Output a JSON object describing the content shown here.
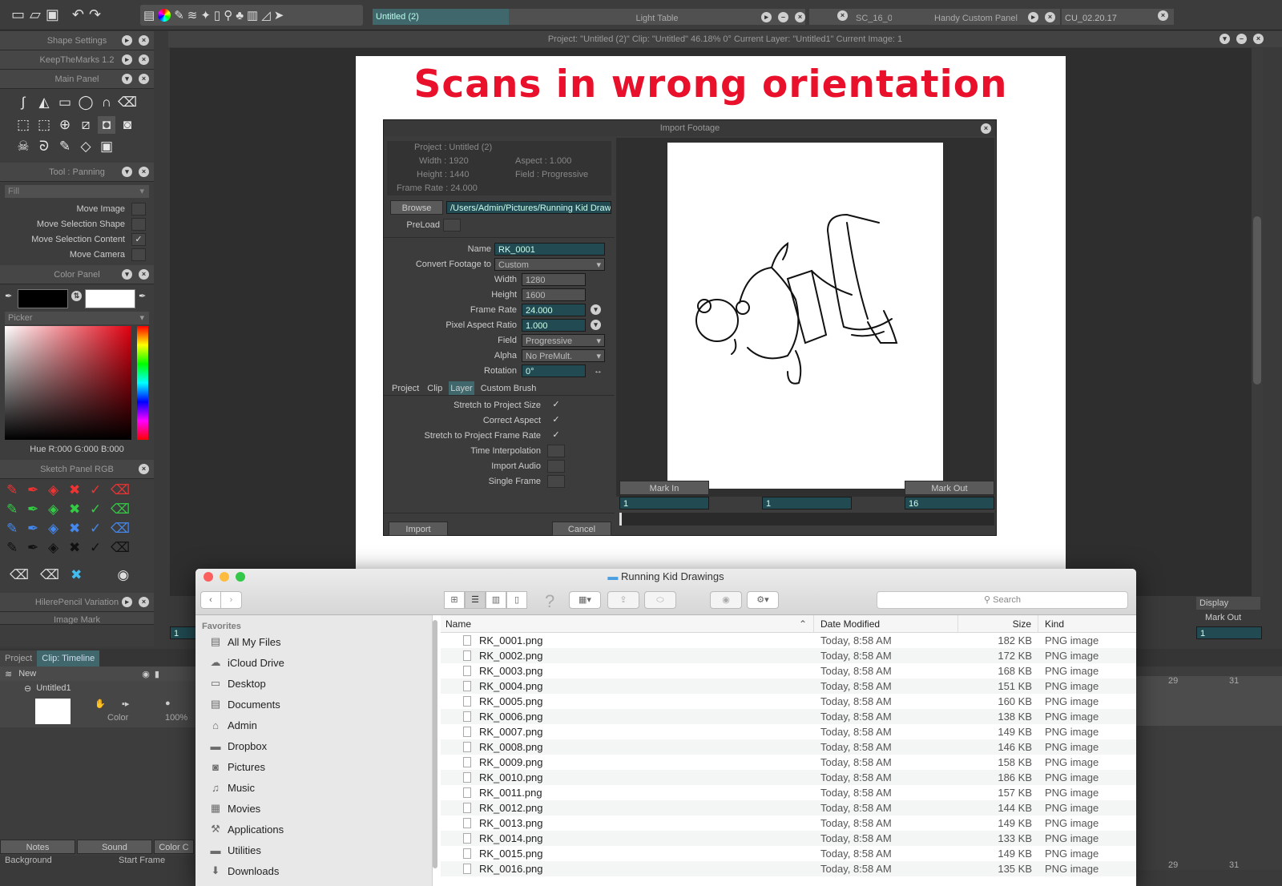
{
  "top_tabs": {
    "doc_tab": "Untitled (2)",
    "light_table": "Light Table",
    "sc_tab": "SC_16_0",
    "handy": "Handy Custom Panel",
    "cu_tab": "CU_02.20.17"
  },
  "status_line": "Project: \"Untitled (2)\"  Clip: \"Untitled\"   46.18%   0°   Current Layer: \"Untitled1\"  Current Image: 1",
  "left": {
    "shape_settings": "Shape Settings",
    "keep_marks": "KeepTheMarks 1.2",
    "main_panel": "Main Panel",
    "tool_panning": "Tool : Panning",
    "fill": "Fill",
    "tool_options": [
      {
        "label": "Move Image",
        "checked": ""
      },
      {
        "label": "Move Selection Shape",
        "checked": ""
      },
      {
        "label": "Move Selection Content",
        "checked": "✓"
      },
      {
        "label": "Move Camera",
        "checked": ""
      }
    ],
    "color_panel": "Color Panel",
    "picker": "Picker",
    "hue_readout": "Hue R:000 G:000 B:000",
    "sketch_panel": "Sketch Panel RGB",
    "hilere": "HilerePencil Variation",
    "image_mark": "Image Mark"
  },
  "timeline": {
    "tab_project": "Project",
    "tab_clip": "Clip: Timeline",
    "new": "New",
    "layer_name": "Untitled1",
    "color": "Color",
    "opacity": "100%",
    "notes": "Notes",
    "sound": "Sound",
    "color_tab": "Color C",
    "background": "Background",
    "start_frame": "Start Frame",
    "frame_29": "29",
    "frame_31": "31",
    "display": "Display",
    "mark_out": "Mark Out",
    "val_1": "1"
  },
  "headline": "Scans in wrong orientation",
  "import": {
    "title": "Import Footage",
    "project": "Project : Untitled (2)",
    "width": "Width : 1920",
    "aspect": "Aspect : 1.000",
    "height": "Height : 1440",
    "field": "Field : Progressive",
    "frame_rate": "Frame Rate : 24.000",
    "browse": "Browse",
    "path": "/Users/Admin/Pictures/Running Kid Draw",
    "preload": "PreLoad",
    "name_label": "Name",
    "name_val": "RK_0001",
    "convert_label": "Convert Footage to",
    "convert_val": "Custom",
    "width_label": "Width",
    "width_val": "1280",
    "height_label": "Height",
    "height_val": "1600",
    "fr_label": "Frame Rate",
    "fr_val": "24.000",
    "par_label": "Pixel Aspect Ratio",
    "par_val": "1.000",
    "field_label": "Field",
    "field_val": "Progressive",
    "alpha_label": "Alpha",
    "alpha_val": "No PreMult.",
    "rot_label": "Rotation",
    "rot_val": "0°",
    "tabs": [
      "Project",
      "Clip",
      "Layer",
      "Custom Brush"
    ],
    "options": [
      {
        "label": "Stretch to Project Size",
        "checked": "✓"
      },
      {
        "label": "Correct Aspect",
        "checked": "✓"
      },
      {
        "label": "Stretch to Project Frame Rate",
        "checked": "✓"
      },
      {
        "label": "Time Interpolation",
        "checked": ""
      },
      {
        "label": "Import Audio",
        "checked": ""
      },
      {
        "label": "Single Frame",
        "checked": ""
      }
    ],
    "import_btn": "Import",
    "cancel_btn": "Cancel",
    "mark_in": "Mark In",
    "mark_out": "Mark Out",
    "in_val": "1",
    "mid_val": "1",
    "out_val": "16"
  },
  "finder": {
    "title": "Running Kid Drawings",
    "search": "Search",
    "favorites": "Favorites",
    "sidebar": [
      "All My Files",
      "iCloud Drive",
      "Desktop",
      "Documents",
      "Admin",
      "Dropbox",
      "Pictures",
      "Music",
      "Movies",
      "Applications",
      "Utilities",
      "Downloads"
    ],
    "cols": {
      "name": "Name",
      "date": "Date Modified",
      "size": "Size",
      "kind": "Kind"
    },
    "files": [
      {
        "n": "RK_0001.png",
        "d": "Today, 8:58 AM",
        "s": "182 KB",
        "k": "PNG image"
      },
      {
        "n": "RK_0002.png",
        "d": "Today, 8:58 AM",
        "s": "172 KB",
        "k": "PNG image"
      },
      {
        "n": "RK_0003.png",
        "d": "Today, 8:58 AM",
        "s": "168 KB",
        "k": "PNG image"
      },
      {
        "n": "RK_0004.png",
        "d": "Today, 8:58 AM",
        "s": "151 KB",
        "k": "PNG image"
      },
      {
        "n": "RK_0005.png",
        "d": "Today, 8:58 AM",
        "s": "160 KB",
        "k": "PNG image"
      },
      {
        "n": "RK_0006.png",
        "d": "Today, 8:58 AM",
        "s": "138 KB",
        "k": "PNG image"
      },
      {
        "n": "RK_0007.png",
        "d": "Today, 8:58 AM",
        "s": "149 KB",
        "k": "PNG image"
      },
      {
        "n": "RK_0008.png",
        "d": "Today, 8:58 AM",
        "s": "146 KB",
        "k": "PNG image"
      },
      {
        "n": "RK_0009.png",
        "d": "Today, 8:58 AM",
        "s": "158 KB",
        "k": "PNG image"
      },
      {
        "n": "RK_0010.png",
        "d": "Today, 8:58 AM",
        "s": "186 KB",
        "k": "PNG image"
      },
      {
        "n": "RK_0011.png",
        "d": "Today, 8:58 AM",
        "s": "157 KB",
        "k": "PNG image"
      },
      {
        "n": "RK_0012.png",
        "d": "Today, 8:58 AM",
        "s": "144 KB",
        "k": "PNG image"
      },
      {
        "n": "RK_0013.png",
        "d": "Today, 8:58 AM",
        "s": "149 KB",
        "k": "PNG image"
      },
      {
        "n": "RK_0014.png",
        "d": "Today, 8:58 AM",
        "s": "133 KB",
        "k": "PNG image"
      },
      {
        "n": "RK_0015.png",
        "d": "Today, 8:58 AM",
        "s": "149 KB",
        "k": "PNG image"
      },
      {
        "n": "RK_0016.png",
        "d": "Today, 8:58 AM",
        "s": "135 KB",
        "k": "PNG image"
      }
    ]
  },
  "colors": {
    "headline": "#e8102a",
    "accent_field": "#214a52",
    "finder_select": "#2b6fd6"
  }
}
